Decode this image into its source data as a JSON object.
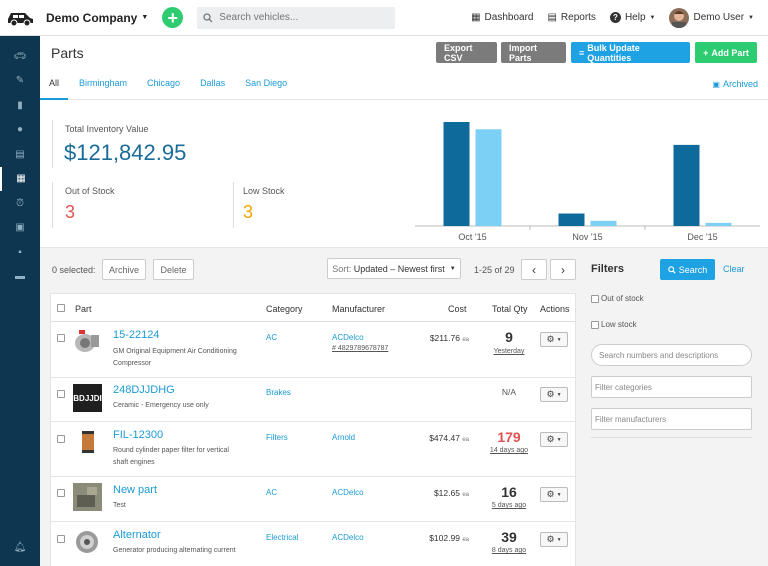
{
  "topbar": {
    "company": "Demo Company",
    "search_placeholder": "Search vehicles...",
    "nav": [
      "Dashboard",
      "Reports",
      "Help",
      "Demo User"
    ]
  },
  "header": {
    "title": "Parts",
    "buttons": [
      "Export CSV",
      "Import Parts",
      "Bulk Update Quantities",
      "Add Part"
    ],
    "tabs": [
      "All",
      "Birmingham",
      "Chicago",
      "Dallas",
      "San Diego"
    ],
    "archived": "Archived"
  },
  "stats": {
    "total_label": "Total Inventory Value",
    "total_value": "$121,842.95",
    "out_label": "Out of Stock",
    "out_value": "3",
    "low_label": "Low Stock",
    "low_value": "3"
  },
  "chart_data": {
    "type": "bar",
    "categories": [
      "Oct '15",
      "Nov '15",
      "Dec '15"
    ],
    "series": [
      {
        "name": "",
        "color": "#0e6a9a",
        "values": [
          100,
          12,
          78
        ]
      },
      {
        "name": "",
        "color": "#7dd0f5",
        "values": [
          93,
          5,
          3
        ]
      }
    ],
    "ylim": [
      0,
      100
    ]
  },
  "toolbar": {
    "selected": "0 selected:",
    "archive": "Archive",
    "delete": "Delete",
    "sort_prefix": "Sort: ",
    "sort_value": "Updated – Newest first",
    "pagination": "1-25 of 29",
    "prev": "‹",
    "next": "›"
  },
  "table": {
    "headers": [
      "Part",
      "Category",
      "Manufacturer",
      "Cost",
      "Total Qty",
      "Actions"
    ],
    "rows": [
      {
        "number": "15-22124",
        "desc1": "GM Original Equipment Air Conditioning",
        "desc2": "Compressor",
        "category": "AC",
        "manufacturer": "ACDelco",
        "mfr_no": "# 4829789678787",
        "cost": "$211.76",
        "ea": "ea",
        "qty": "9",
        "qty_color": "#333",
        "qdate": "Yesterday"
      },
      {
        "number": "248DJJDHG",
        "desc1": "Ceramic - Emergency use only",
        "desc2": "",
        "category": "Brakes",
        "manufacturer": "",
        "mfr_no": "",
        "cost": "",
        "ea": "",
        "qty": "N/A",
        "qty_color": "#555",
        "qdate": ""
      },
      {
        "number": "FIL-12300",
        "desc1": "Round cylinder paper filter for vertical",
        "desc2": "shaft engines",
        "category": "Filters",
        "manufacturer": "Arnold",
        "mfr_no": "",
        "cost": "$474.47",
        "ea": "ea",
        "qty": "179",
        "qty_color": "#e05252",
        "qdate": "14 days ago"
      },
      {
        "number": "New part",
        "desc1": "Test",
        "desc2": "",
        "category": "AC",
        "manufacturer": "ACDelco",
        "mfr_no": "",
        "cost": "$12.65",
        "ea": "ea",
        "qty": "16",
        "qty_color": "#333",
        "qdate": "5 days ago"
      },
      {
        "number": "Alternator",
        "desc1": "Generator producing alternating current",
        "desc2": "",
        "category": "Electrical",
        "manufacturer": "ACDelco",
        "mfr_no": "",
        "cost": "$102.99",
        "ea": "ea",
        "qty": "39",
        "qty_color": "#333",
        "qdate": "8 days ago"
      }
    ],
    "thumb_text": "BDJJDI"
  },
  "filters": {
    "title": "Filters",
    "search": "Search",
    "clear": "Clear",
    "out_of_stock": "Out of stock",
    "low_stock": "Low stock",
    "search_placeholder": "Search numbers and descriptions",
    "categories_placeholder": "Filter categories",
    "manufacturers_placeholder": "Filter manufacturers"
  }
}
